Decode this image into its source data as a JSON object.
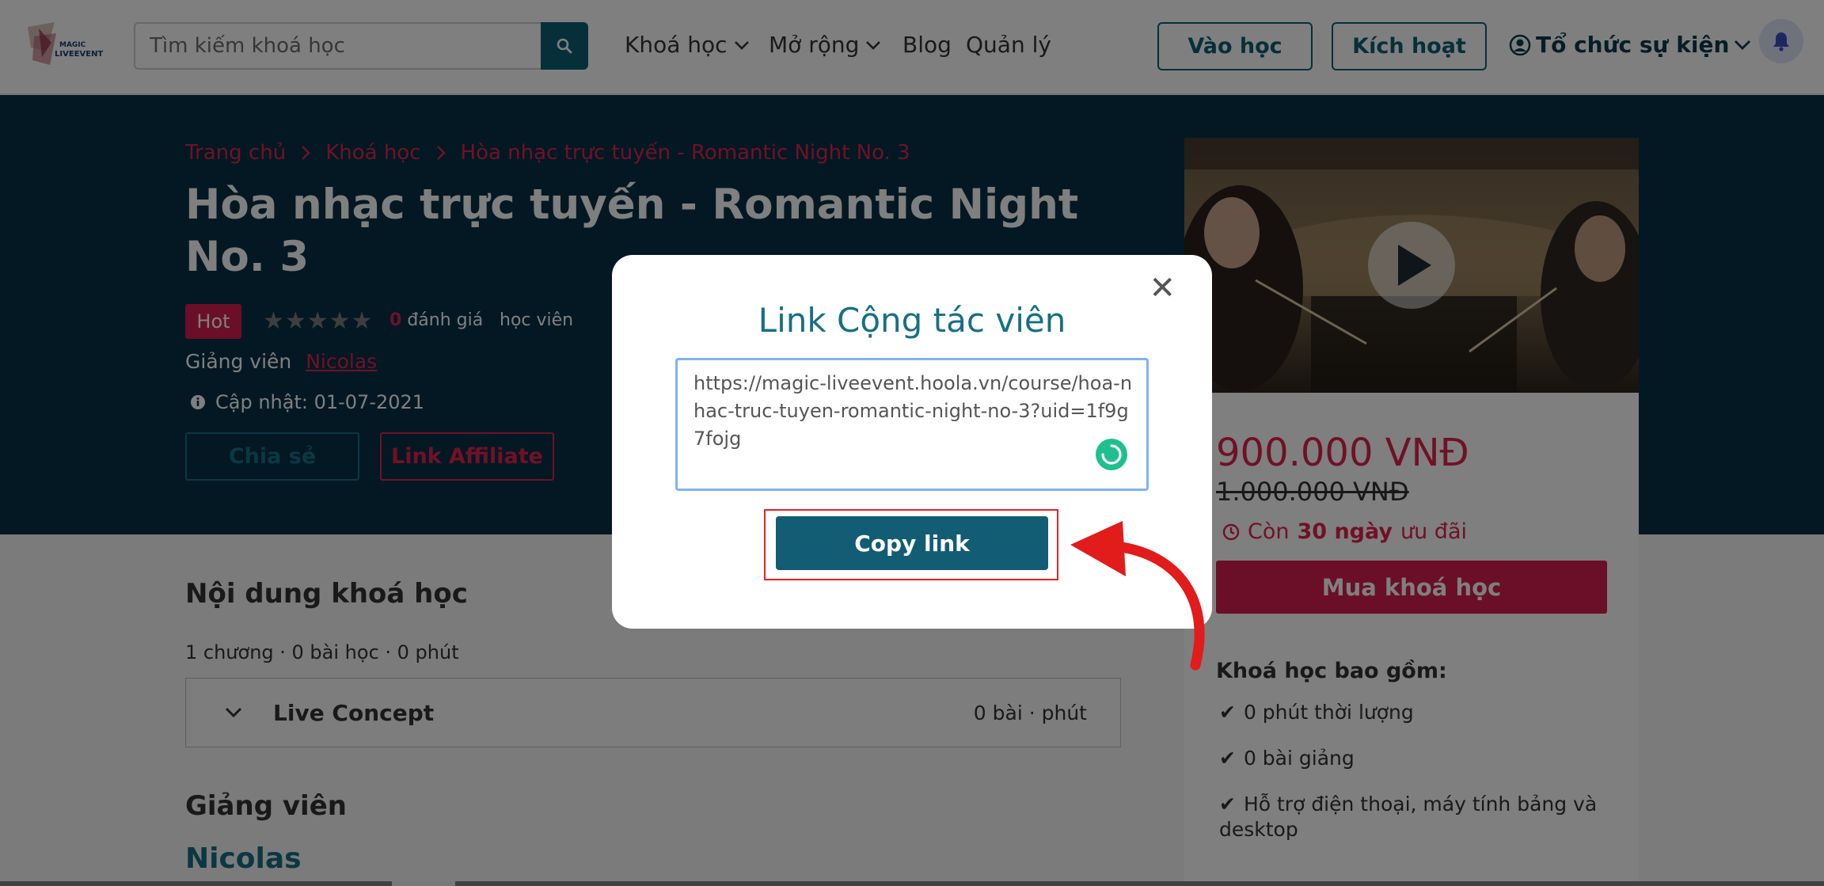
{
  "header": {
    "search_placeholder": "Tìm kiếm khoá học",
    "nav": [
      "Khoá học",
      "Mở rộng",
      "Blog",
      "Quản lý"
    ],
    "btn_learn": "Vào học",
    "btn_activate": "Kích hoạt",
    "org_menu": "Tổ chức sự kiện"
  },
  "hero": {
    "breadcrumb": [
      "Trang chủ",
      "Khoá học",
      "Hòa nhạc trực tuyến - Romantic Night No. 3"
    ],
    "title": "Hòa nhạc trực tuyến - Romantic Night No. 3",
    "badge": "Hot",
    "stars": "★★★★★",
    "rating_count": "0",
    "rating_label": "đánh giá",
    "students_label": "học viên",
    "instructor_label": "Giảng viên",
    "instructor_name": "Nicolas",
    "updated": "Cập nhật: 01-07-2021",
    "share_label": "Chia sẻ",
    "affiliate_label": "Link Affiliate"
  },
  "card": {
    "price": "900.000 VNĐ",
    "old_price": "1.000.000 VNĐ",
    "discount_prefix": "Còn",
    "discount_days": "30 ngày",
    "discount_suffix": "ưu đãi",
    "buy_label": "Mua khoá học",
    "includes_title": "Khoá học bao gồm:",
    "includes": [
      "0 phút thời lượng",
      "0 bài giảng",
      "Hỗ trợ điện thoại, máy tính bảng và desktop"
    ]
  },
  "content": {
    "section_title": "Nội dung khoá học",
    "stats": "1 chương · 0 bài học · 0 phút",
    "chapter_title": "Live Concept",
    "chapter_meta": "0 bài · phút",
    "instructor_section": "Giảng viên",
    "instructor_name": "Nicolas"
  },
  "modal": {
    "title": "Link Cộng tác viên",
    "link": "https://magic-liveevent.hoola.vn/course/hoa-nhac-truc-tuyen-romantic-night-no-3?uid=1f9g7fojg",
    "copy_label": "Copy link"
  },
  "colors": {
    "primary": "#0f5f75",
    "accent": "#e0224f",
    "hero_bg": "#073146"
  }
}
